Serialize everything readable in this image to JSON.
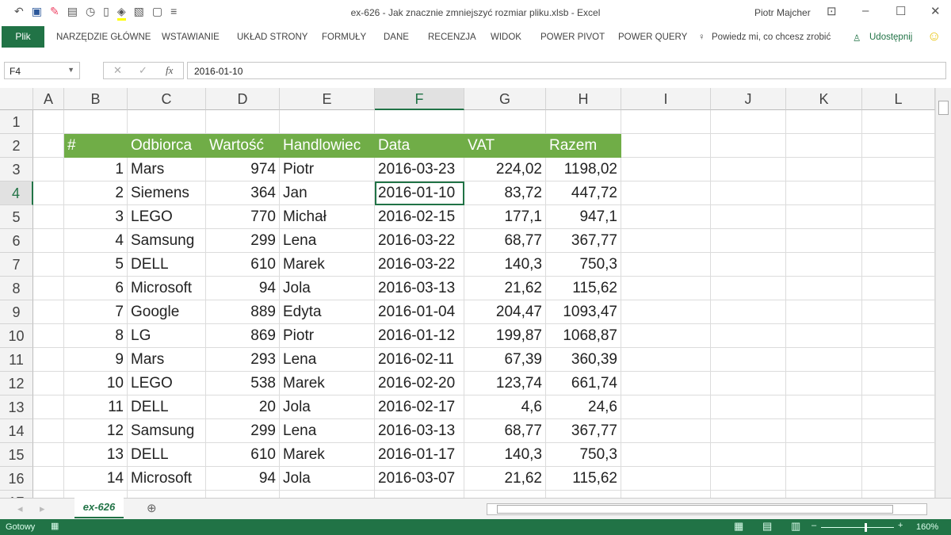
{
  "window": {
    "title": "ex-626 - Jak znacznie zmniejszyć rozmiar pliku.xlsb - Excel",
    "user": "Piotr Majcher",
    "qat_icons": [
      "undo-icon",
      "save-icon",
      "eraser-icon",
      "form-icon",
      "clock-icon",
      "clipboard-icon",
      "fill-color-icon",
      "picture-icon",
      "comment-icon",
      "customize-icon"
    ]
  },
  "ribbon": {
    "file": "Plik",
    "tabs": [
      "NARZĘDZIE GŁÓWNE",
      "WSTAWIANIE",
      "UKŁAD STRONY",
      "FORMUŁY",
      "DANE",
      "RECENZJA",
      "WIDOK",
      "POWER PIVOT",
      "POWER QUERY"
    ],
    "tell_me": "Powiedz mi, co chcesz zrobić",
    "share": "Udostępnij"
  },
  "formula_bar": {
    "name_box": "F4",
    "fx": "fx",
    "value": "2016-01-10"
  },
  "columns": [
    "A",
    "B",
    "C",
    "D",
    "E",
    "F",
    "G",
    "H",
    "I",
    "J",
    "K",
    "L"
  ],
  "selected_column": "F",
  "selected_row": 4,
  "header_row": [
    "#",
    "Odbiorca",
    "Wartość",
    "Handlowiec",
    "Data",
    "VAT",
    "Razem"
  ],
  "rows": [
    [
      "1",
      "Mars",
      "974",
      "Piotr",
      "2016-03-23",
      "224,02",
      "1198,02"
    ],
    [
      "2",
      "Siemens",
      "364",
      "Jan",
      "2016-01-10",
      "83,72",
      "447,72"
    ],
    [
      "3",
      "LEGO",
      "770",
      "Michał",
      "2016-02-15",
      "177,1",
      "947,1"
    ],
    [
      "4",
      "Samsung",
      "299",
      "Lena",
      "2016-03-22",
      "68,77",
      "367,77"
    ],
    [
      "5",
      "DELL",
      "610",
      "Marek",
      "2016-03-22",
      "140,3",
      "750,3"
    ],
    [
      "6",
      "Microsoft",
      "94",
      "Jola",
      "2016-03-13",
      "21,62",
      "115,62"
    ],
    [
      "7",
      "Google",
      "889",
      "Edyta",
      "2016-01-04",
      "204,47",
      "1093,47"
    ],
    [
      "8",
      "LG",
      "869",
      "Piotr",
      "2016-01-12",
      "199,87",
      "1068,87"
    ],
    [
      "9",
      "Mars",
      "293",
      "Lena",
      "2016-02-11",
      "67,39",
      "360,39"
    ],
    [
      "10",
      "LEGO",
      "538",
      "Marek",
      "2016-02-20",
      "123,74",
      "661,74"
    ],
    [
      "11",
      "DELL",
      "20",
      "Jola",
      "2016-02-17",
      "4,6",
      "24,6"
    ],
    [
      "12",
      "Samsung",
      "299",
      "Lena",
      "2016-03-13",
      "68,77",
      "367,77"
    ],
    [
      "13",
      "DELL",
      "610",
      "Marek",
      "2016-01-17",
      "140,3",
      "750,3"
    ],
    [
      "14",
      "Microsoft",
      "94",
      "Jola",
      "2016-03-07",
      "21,62",
      "115,62"
    ]
  ],
  "sheet": {
    "tab": "ex-626"
  },
  "status": {
    "text": "Gotowy",
    "zoom": "160%",
    "zoom_level": 160
  },
  "colors": {
    "accent": "#217346",
    "header_fill": "#70ad47"
  }
}
